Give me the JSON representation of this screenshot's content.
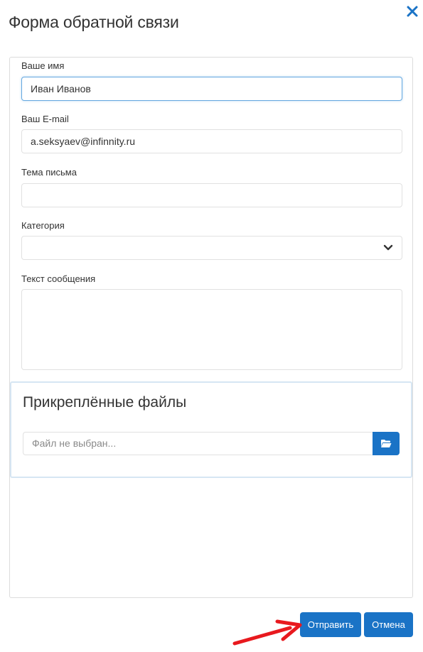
{
  "dialog": {
    "title": "Форма обратной связи"
  },
  "form": {
    "name_label": "Ваше имя",
    "name_value": "Иван Иванов",
    "email_label": "Ваш E-mail",
    "email_value": "a.seksyaev@infinnity.ru",
    "subject_label": "Тема письма",
    "subject_value": "",
    "category_label": "Категория",
    "category_value": "",
    "message_label": "Текст сообщения",
    "message_value": ""
  },
  "attachments": {
    "title": "Прикреплённые файлы",
    "file_placeholder": "Файл не выбран...",
    "browse_icon": "folder-open-icon"
  },
  "actions": {
    "submit_label": "Отправить",
    "cancel_label": "Отмена"
  },
  "icons": {
    "close": "close-icon",
    "category_dropdown": "chevron-down-icon"
  },
  "colors": {
    "accent": "#1a73c6",
    "annotation_arrow": "#e8191e"
  }
}
